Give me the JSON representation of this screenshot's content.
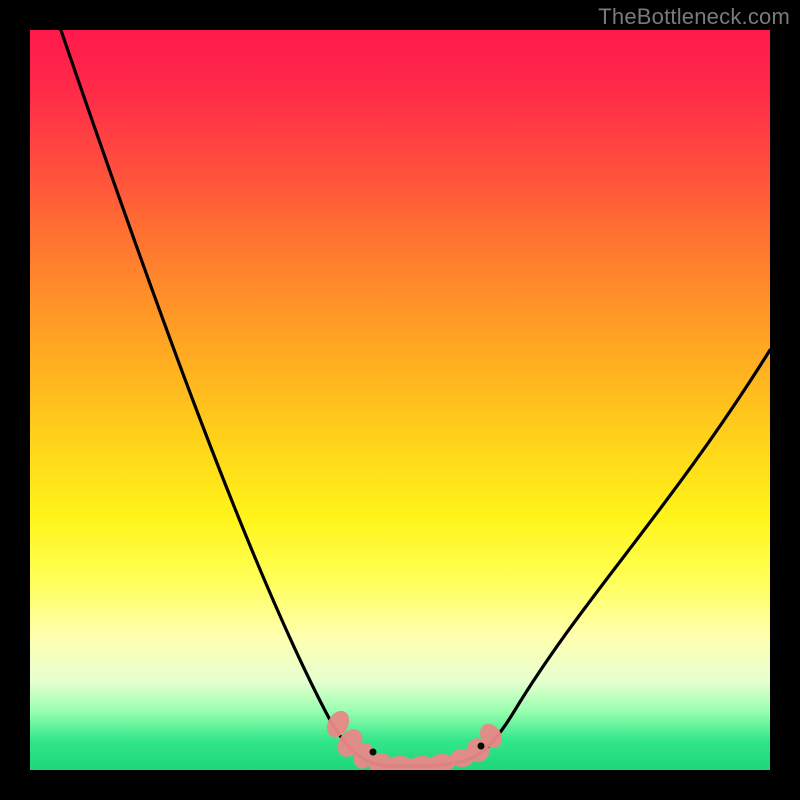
{
  "watermark": "TheBottleneck.com",
  "colors": {
    "background": "#000000",
    "gradient_top": "#ff1a4d",
    "gradient_bottom": "#1fd67a",
    "curve": "#000000",
    "marker": "#e98987"
  },
  "chart_data": {
    "type": "line",
    "title": "",
    "xlabel": "",
    "ylabel": "",
    "xlim": [
      0,
      1
    ],
    "ylim": [
      0,
      1
    ],
    "note": "Chart has no visible axis ticks or numeric labels; values below are normalized estimates read from curve geometry.",
    "series": [
      {
        "name": "left-branch",
        "x": [
          0.03,
          0.09,
          0.15,
          0.21,
          0.27,
          0.32,
          0.37,
          0.41,
          0.45
        ],
        "y": [
          1.0,
          0.83,
          0.66,
          0.5,
          0.35,
          0.22,
          0.12,
          0.05,
          0.01
        ]
      },
      {
        "name": "valley-floor",
        "x": [
          0.45,
          0.49,
          0.53,
          0.57,
          0.6
        ],
        "y": [
          0.01,
          0.0,
          0.0,
          0.0,
          0.01
        ]
      },
      {
        "name": "right-branch",
        "x": [
          0.6,
          0.66,
          0.73,
          0.8,
          0.87,
          0.94,
          1.0
        ],
        "y": [
          0.01,
          0.05,
          0.12,
          0.22,
          0.33,
          0.45,
          0.57
        ]
      }
    ],
    "marker_clusters": [
      {
        "x_range": [
          0.42,
          0.48
        ],
        "y_range": [
          0.0,
          0.05
        ]
      },
      {
        "x_range": [
          0.56,
          0.62
        ],
        "y_range": [
          0.0,
          0.05
        ]
      }
    ]
  }
}
